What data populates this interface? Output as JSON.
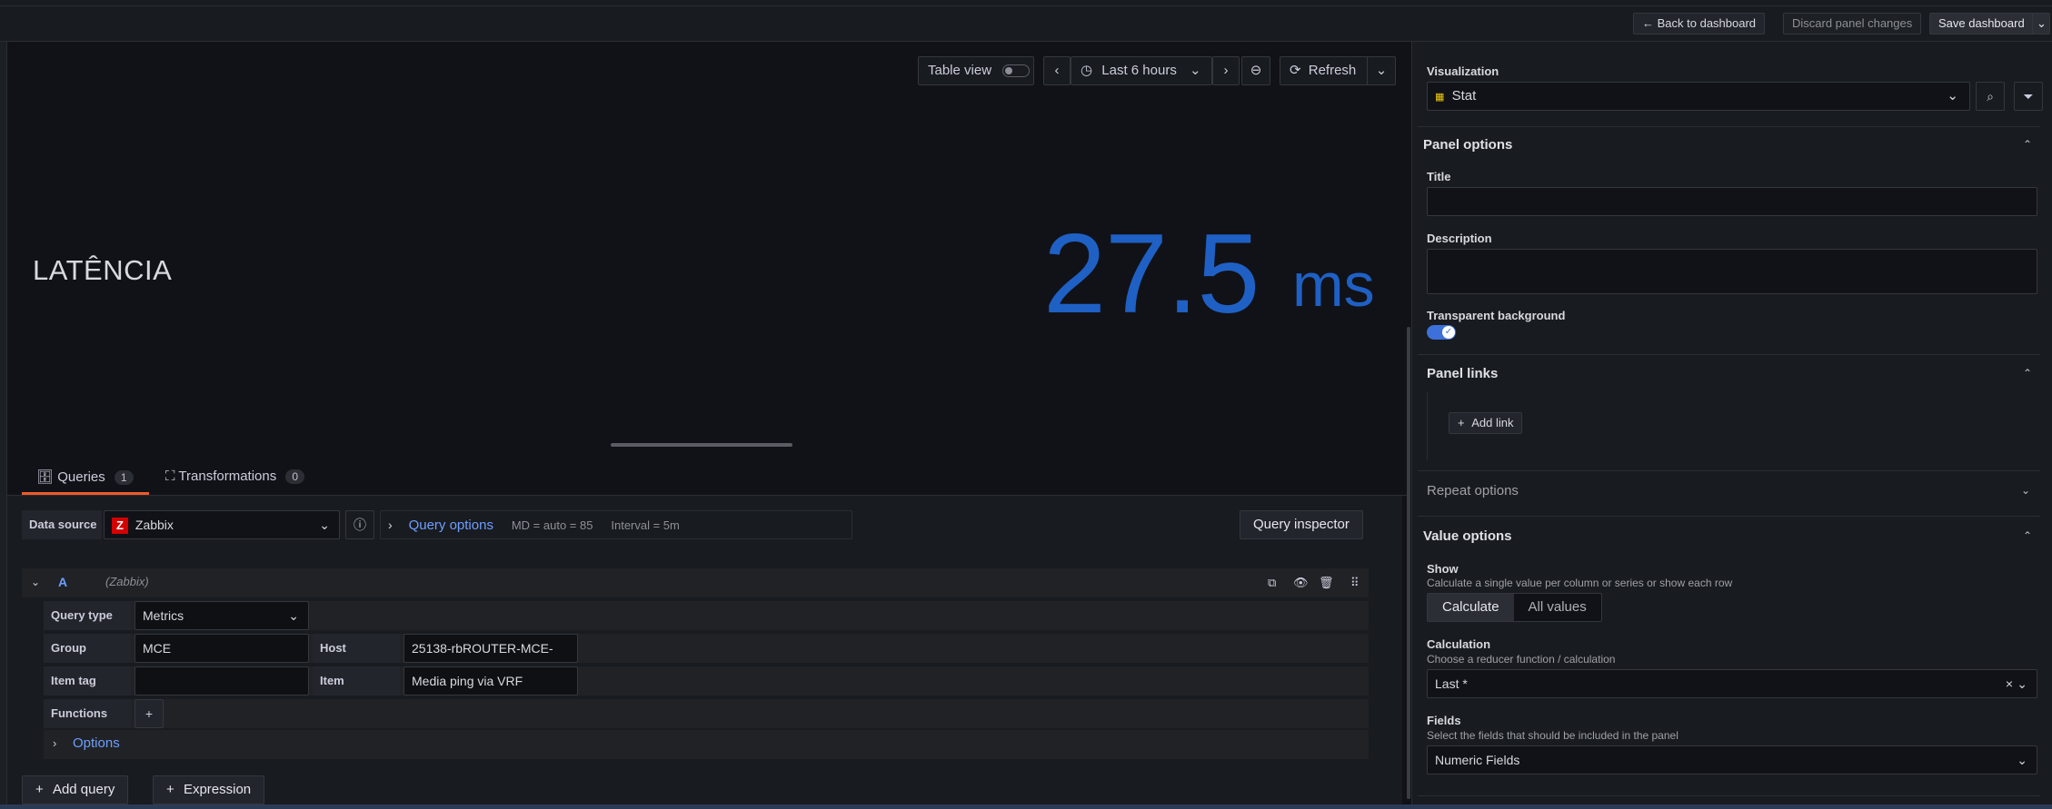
{
  "topbar": {
    "back": "Back to dashboard",
    "discard": "Discard panel changes",
    "save": "Save dashboard"
  },
  "preview_toolbar": {
    "table_view": "Table view",
    "time_range": "Last 6 hours",
    "refresh": "Refresh"
  },
  "stat": {
    "title": "LATÊNCIA",
    "value": "27.5",
    "unit": "ms",
    "color": "#1f60c4"
  },
  "tabs": {
    "queries": "Queries",
    "queries_count": "1",
    "transformations": "Transformations",
    "transformations_count": "0"
  },
  "query_bar": {
    "datasource_label": "Data source",
    "datasource": "Zabbix",
    "query_options": "Query options",
    "md": "MD = auto = 85",
    "interval": "Interval = 5m",
    "inspector": "Query inspector"
  },
  "query": {
    "ref": "A",
    "source": "(Zabbix)",
    "query_type_label": "Query type",
    "query_type": "Metrics",
    "group_label": "Group",
    "group": "MCE",
    "host_label": "Host",
    "host": "25138-rbROUTER-MCE-",
    "item_tag_label": "Item tag",
    "item_tag": "",
    "item_label": "Item",
    "item": "Media ping via VRF",
    "functions_label": "Functions",
    "options": "Options"
  },
  "bottom_buttons": {
    "add_query": "Add query",
    "expression": "Expression"
  },
  "options_pane": {
    "viz_label": "Visualization",
    "viz": "Stat",
    "panel_options": "Panel options",
    "title_label": "Title",
    "title_value": "",
    "description_label": "Description",
    "transparent_label": "Transparent background",
    "panel_links": "Panel links",
    "add_link": "Add link",
    "repeat_options": "Repeat options",
    "value_options": "Value options",
    "show_label": "Show",
    "show_desc": "Calculate a single value per column or series or show each row",
    "show_calc": "Calculate",
    "show_all": "All values",
    "calc_label": "Calculation",
    "calc_desc": "Choose a reducer function / calculation",
    "calc_value": "Last *",
    "fields_label": "Fields",
    "fields_desc": "Select the fields that should be included in the panel",
    "fields_value": "Numeric Fields"
  }
}
